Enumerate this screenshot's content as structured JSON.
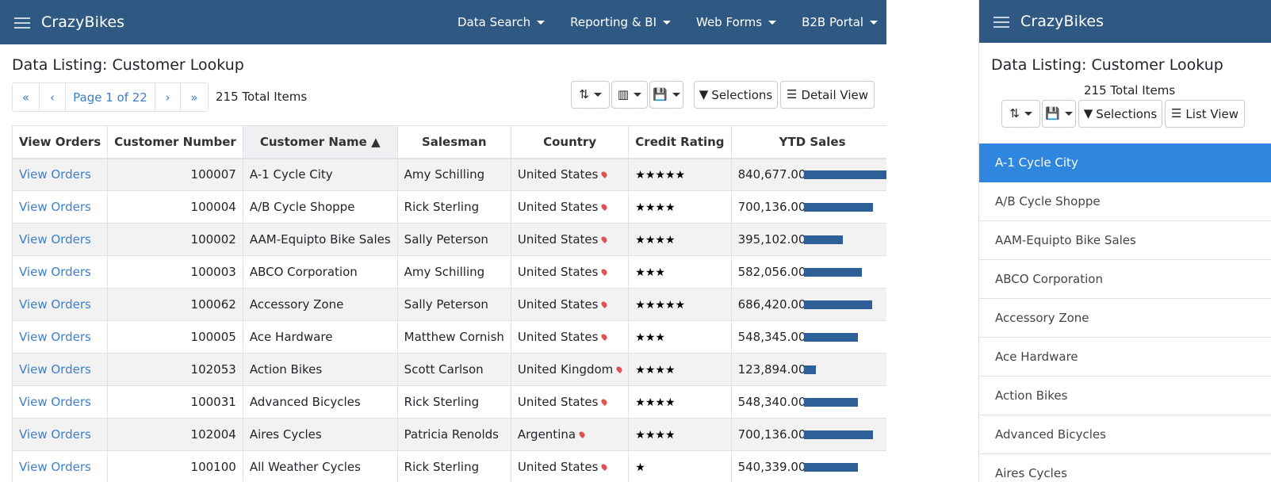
{
  "app": {
    "brand": "CrazyBikes"
  },
  "nav": [
    "Data Search",
    "Reporting & BI",
    "Web Forms",
    "B2B Portal"
  ],
  "page": {
    "title": "Data Listing: Customer Lookup",
    "total": "215 Total Items"
  },
  "pager": {
    "first": "«",
    "prev": "‹",
    "page": "Page 1 of 22",
    "next": "›",
    "last": "»"
  },
  "toolbar": {
    "selections": "Selections",
    "detail_view": "Detail View",
    "list_view": "List View"
  },
  "icons": {
    "sort": "sort-amount-icon",
    "columns": "columns-icon",
    "save": "save-icon",
    "filter": "filter-icon",
    "list": "list-icon",
    "pin": "map-pin-icon"
  },
  "table": {
    "headers": [
      "View Orders",
      "Customer Number",
      "Customer Name ▲",
      "Salesman",
      "Country",
      "Credit Rating",
      "YTD Sales"
    ],
    "rows": [
      [
        "View Orders",
        "100007",
        "A-1 Cycle City",
        "Amy Schilling",
        "United States",
        "★★★★★",
        "840,677.00"
      ],
      [
        "View Orders",
        "100004",
        "A/B Cycle Shoppe",
        "Rick Sterling",
        "United States",
        "★★★★",
        "700,136.00"
      ],
      [
        "View Orders",
        "100002",
        "AAM-Equipto Bike Sales",
        "Sally Peterson",
        "United States",
        "★★★★",
        "395,102.00"
      ],
      [
        "View Orders",
        "100003",
        "ABCO Corporation",
        "Amy Schilling",
        "United States",
        "★★★",
        "582,056.00"
      ],
      [
        "View Orders",
        "100062",
        "Accessory Zone",
        "Sally Peterson",
        "United States",
        "★★★★★",
        "686,420.00"
      ],
      [
        "View Orders",
        "100005",
        "Ace Hardware",
        "Matthew Cornish",
        "United States",
        "★★★",
        "548,345.00"
      ],
      [
        "View Orders",
        "102053",
        "Action Bikes",
        "Scott Carlson",
        "United Kingdom",
        "★★★★",
        "123,894.00"
      ],
      [
        "View Orders",
        "100031",
        "Advanced Bicycles",
        "Rick Sterling",
        "United States",
        "★★★★",
        "548,340.00"
      ],
      [
        "View Orders",
        "102004",
        "Aires Cycles",
        "Patricia Renolds",
        "Argentina",
        "★★★★",
        "700,136.00"
      ],
      [
        "View Orders",
        "100100",
        "All Weather Cycles",
        "Rick Sterling",
        "United States",
        "★",
        "540,339.00"
      ]
    ],
    "ytd_fraction": [
      1.0,
      0.833,
      0.47,
      0.692,
      0.817,
      0.652,
      0.147,
      0.652,
      0.833,
      0.643
    ]
  },
  "list": [
    "A-1 Cycle City",
    "A/B Cycle Shoppe",
    "AAM-Equipto Bike Sales",
    "ABCO Corporation",
    "Accessory Zone",
    "Ace Hardware",
    "Action Bikes",
    "Advanced Bicycles",
    "Aires Cycles"
  ],
  "colors": {
    "nav_bg": "#2f5982",
    "link": "#3d7fc9",
    "bar": "#2f5f97",
    "active": "#2e86de"
  }
}
